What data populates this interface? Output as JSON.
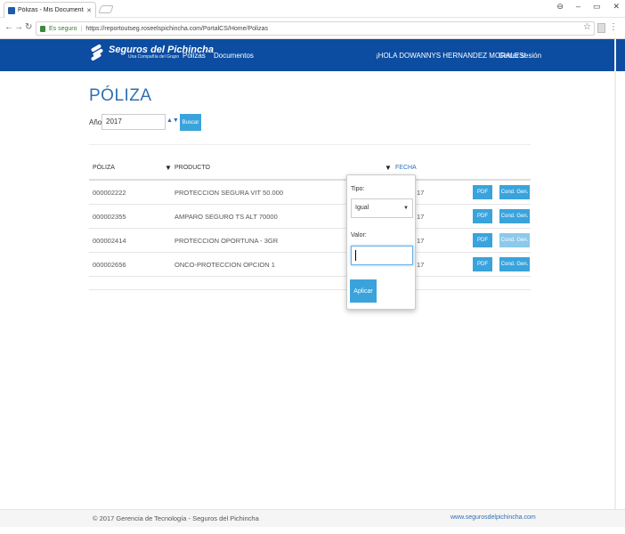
{
  "browser": {
    "tab_title": "Pólizas - Mis Documentos",
    "secure_label": "Es seguro",
    "url": "https://reportoutseg.roseelspichincha.com/PortalCS/Home/Polizas"
  },
  "navbar": {
    "brand_name": "Seguros del Pichincha",
    "brand_tagline": "Una Compañía del Grupo",
    "links": [
      "Pólizas",
      "Documentos"
    ],
    "greeting": "¡HOLA DOWANNYS HERNANDEZ MORALES!",
    "logout": "Cerrar sesión"
  },
  "page": {
    "title": "PÓLIZA",
    "year_label": "Año",
    "year_value": "2017",
    "search_button": "Buscar"
  },
  "table": {
    "headers": [
      "PÓLIZA",
      "PRODUCTO",
      "FECHA"
    ],
    "rows": [
      {
        "poliza": "000002222",
        "producto": "PROTECCION SEGURA VIT 50.000",
        "fecha": "17",
        "pdf": "PDF",
        "cond": "Cond. Gen."
      },
      {
        "poliza": "000002355",
        "producto": "AMPARO SEGURO TS ALT 70000",
        "fecha": "17",
        "pdf": "PDF",
        "cond": "Cond. Gen."
      },
      {
        "poliza": "000002414",
        "producto": "PROTECCION OPORTUNA - 3GR",
        "fecha": "17",
        "pdf": "PDF",
        "cond": "Cond. Gen."
      },
      {
        "poliza": "000002656",
        "producto": "ONCO-PROTECCION OPCION 1",
        "fecha": "17",
        "pdf": "PDF",
        "cond": "Cond. Gen."
      }
    ]
  },
  "filter_popup": {
    "tipo_label": "Tipo:",
    "tipo_value": "Igual",
    "valor_label": "Valor:",
    "valor_value": "",
    "apply_button": "Aplicar"
  },
  "footer": {
    "copyright": "© 2017 Gerencia de Tecnología - Seguros del Pichincha",
    "website": "www.segurosdelpichincha.com"
  },
  "colors": {
    "navbar": "#0c4da1",
    "accent": "#3aa3dc",
    "title": "#2f6fb5"
  }
}
